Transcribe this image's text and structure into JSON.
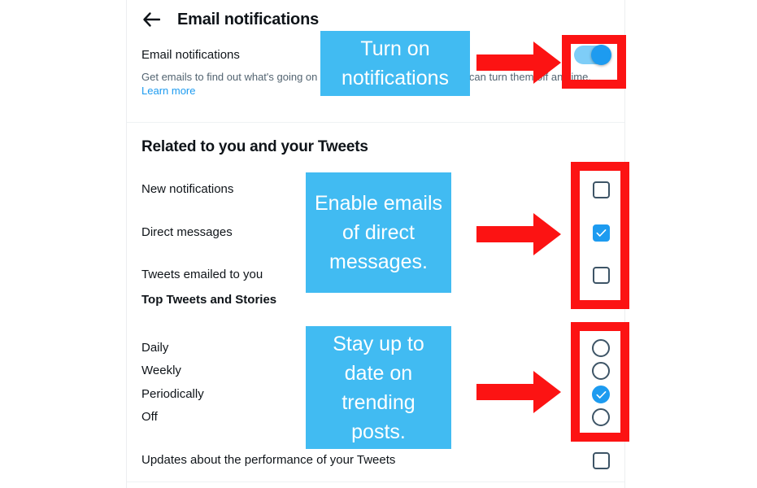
{
  "header": {
    "title": "Email notifications",
    "back_icon": "arrow-left-icon"
  },
  "master": {
    "label": "Email notifications",
    "description": "Get emails to find out what's going on when you're not on Twitter. You can turn them off anytime.",
    "learn_more": "Learn more",
    "toggle_state": "on"
  },
  "sections": {
    "related": {
      "title": "Related to you and your Tweets",
      "options": [
        {
          "label": "New notifications",
          "checked": false
        },
        {
          "label": "Direct messages",
          "checked": true
        },
        {
          "label": "Tweets emailed to you",
          "checked": false
        }
      ]
    },
    "top_tweets": {
      "title": "Top Tweets and Stories",
      "options": [
        {
          "label": "Daily",
          "selected": false
        },
        {
          "label": "Weekly",
          "selected": false
        },
        {
          "label": "Periodically",
          "selected": true
        },
        {
          "label": "Off",
          "selected": false
        }
      ]
    },
    "updates": {
      "label": "Updates about the performance of your Tweets",
      "checked": false
    }
  },
  "annotations": {
    "callouts": [
      {
        "text": "Turn on notifications"
      },
      {
        "text": "Enable emails of direct messages."
      },
      {
        "text": "Stay up to date on trending posts."
      }
    ],
    "arrow_icon": "arrow-right-icon",
    "highlight_color": "#fc1313",
    "callout_color": "#41bbf2"
  },
  "colors": {
    "accent": "#1d9bf0",
    "text_primary": "#0f1419",
    "text_secondary": "#536471"
  }
}
